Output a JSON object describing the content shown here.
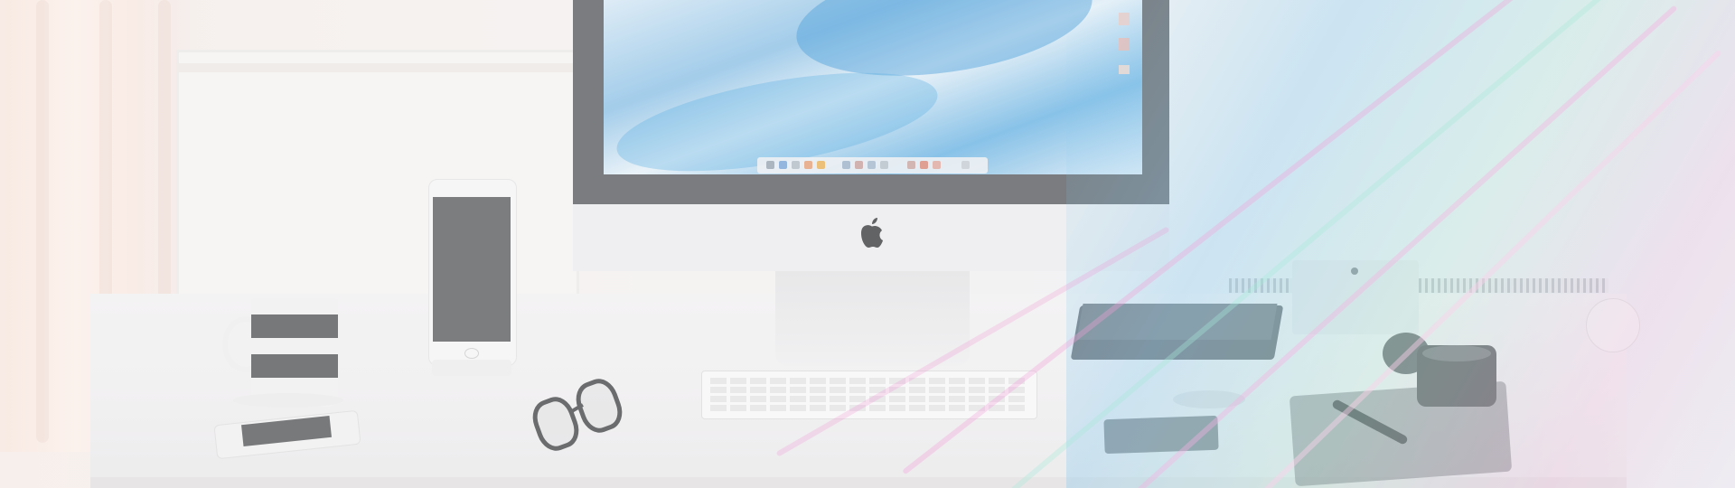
{
  "scene": {
    "description_visible_text": "",
    "colors": {
      "screen_blue": "#6fb5e3",
      "overlay_pink": "#e6a0d2",
      "overlay_cyan": "#8cdcc8",
      "bezel": "#5d6064"
    },
    "icons": [
      "apple-logo-icon"
    ]
  }
}
